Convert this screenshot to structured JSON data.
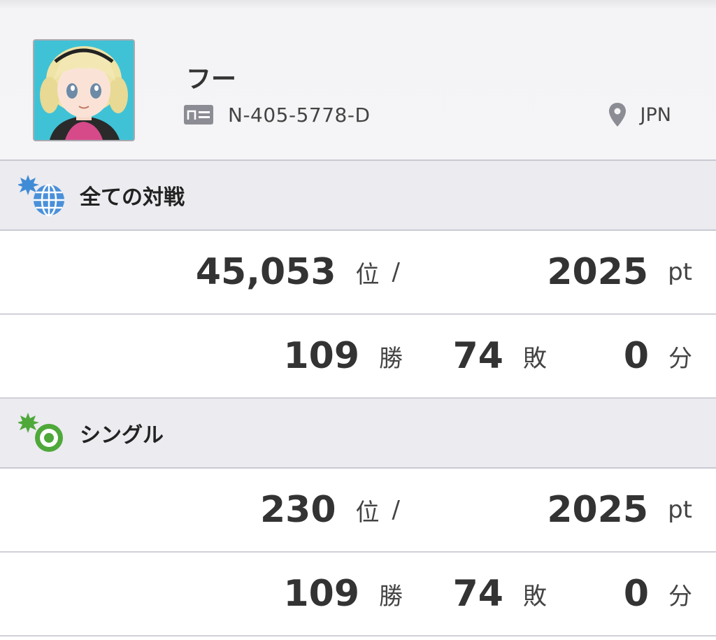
{
  "profile": {
    "name": "フー",
    "player_id": "N-405-5778-D",
    "region": "JPN",
    "icons": {
      "avatar": "trainer-avatar",
      "id": "id-card-icon",
      "region": "location-pin-icon"
    }
  },
  "sections": [
    {
      "title": "全ての対戦",
      "icon": "globe-icon",
      "rank": "45,053",
      "rank_unit": "位",
      "separator": "/",
      "points": "2025",
      "points_unit": "pt",
      "wins": "109",
      "wins_unit": "勝",
      "losses": "74",
      "losses_unit": "敗",
      "draws": "0",
      "draws_unit": "分"
    },
    {
      "title": "シングル",
      "icon": "single-battle-icon",
      "rank": "230",
      "rank_unit": "位",
      "separator": "/",
      "points": "2025",
      "points_unit": "pt",
      "wins": "109",
      "wins_unit": "勝",
      "losses": "74",
      "losses_unit": "敗",
      "draws": "0",
      "draws_unit": "分"
    }
  ],
  "colors": {
    "globe_icon": "#4a90d9",
    "single_icon": "#4fa83a",
    "header_bg": "#ebebf0",
    "divider": "#c9c9d3"
  }
}
